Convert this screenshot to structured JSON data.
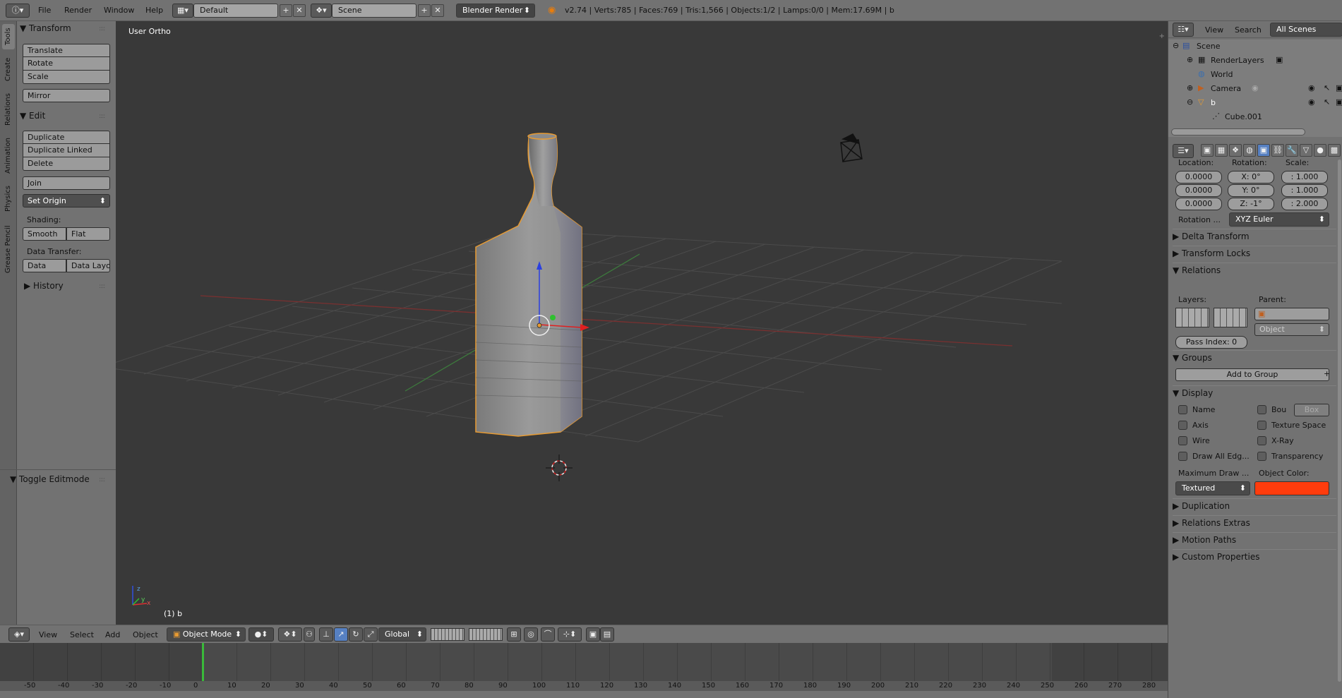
{
  "topbar": {
    "menus": [
      "File",
      "Render",
      "Window",
      "Help"
    ],
    "layout": "Default",
    "scene": "Scene",
    "engine": "Blender Render",
    "stats": "v2.74 | Verts:785 | Faces:769 | Tris:1,566 | Objects:1/2 | Lamps:0/0 | Mem:17.69M | b"
  },
  "lefttabs": [
    "Tools",
    "Create",
    "Relations",
    "Animation",
    "Physics",
    "Grease Pencil"
  ],
  "toolshelf": {
    "transform_header": "Transform",
    "translate": "Translate",
    "rotate": "Rotate",
    "scale": "Scale",
    "mirror": "Mirror",
    "edit_header": "Edit",
    "duplicate": "Duplicate",
    "duplicate_linked": "Duplicate Linked",
    "delete": "Delete",
    "join": "Join",
    "set_origin": "Set Origin",
    "shading_label": "Shading:",
    "smooth": "Smooth",
    "flat": "Flat",
    "data_transfer_label": "Data Transfer:",
    "data": "Data",
    "data_layo": "Data Layo",
    "history_header": "History",
    "toggle_editmode": "Toggle Editmode"
  },
  "viewport": {
    "view_label": "User Ortho",
    "object_label": "(1) b"
  },
  "vheader": {
    "menus": [
      "View",
      "Select",
      "Add",
      "Object"
    ],
    "mode": "Object Mode",
    "orientation": "Global"
  },
  "timeline": {
    "ticks": [
      "-50",
      "-40",
      "-30",
      "-20",
      "-10",
      "0",
      "10",
      "20",
      "30",
      "40",
      "50",
      "60",
      "70",
      "80",
      "90",
      "100",
      "110",
      "120",
      "130",
      "140",
      "150",
      "160",
      "170",
      "180",
      "190",
      "200",
      "210",
      "220",
      "230",
      "240",
      "250",
      "260",
      "270",
      "280"
    ],
    "current_frame": 0
  },
  "outliner": {
    "menus": [
      "View",
      "Search"
    ],
    "filter": "All Scenes",
    "items": {
      "scene": "Scene",
      "renderlayers": "RenderLayers",
      "world": "World",
      "camera": "Camera",
      "b": "b",
      "cube": "Cube.001"
    }
  },
  "props": {
    "location_label": "Location:",
    "rotation_label": "Rotation:",
    "scale_label": "Scale:",
    "loc": [
      "0.0000",
      "0.0000",
      "0.0000"
    ],
    "rot": [
      "X:   0°",
      "Y:   0°",
      "Z:  -1°"
    ],
    "scl": [
      ": 1.000",
      ": 1.000",
      ": 2.000"
    ],
    "rotation_mode_label": "Rotation ...",
    "rotation_mode": "XYZ Euler",
    "delta_transform": "Delta Transform",
    "transform_locks": "Transform Locks",
    "relations": "Relations",
    "layers_label": "Layers:",
    "parent_label": "Parent:",
    "parent_type": "Object",
    "pass_index": "Pass Index:",
    "pass_index_value": "0",
    "groups": "Groups",
    "add_to_group": "Add to Group",
    "display": "Display",
    "name": "Name",
    "bou": "Bou",
    "box": "Box",
    "axis": "Axis",
    "texture_space": "Texture Space",
    "wire": "Wire",
    "xray": "X-Ray",
    "draw_all_edges": "Draw All Edg...",
    "transparency": "Transparency",
    "max_draw_label": "Maximum Draw ...",
    "object_color_label": "Object Color:",
    "max_draw": "Textured",
    "object_color": "#ff3c0d",
    "duplication": "Duplication",
    "relations_extras": "Relations Extras",
    "motion_paths": "Motion Paths",
    "custom_properties": "Custom Properties"
  }
}
